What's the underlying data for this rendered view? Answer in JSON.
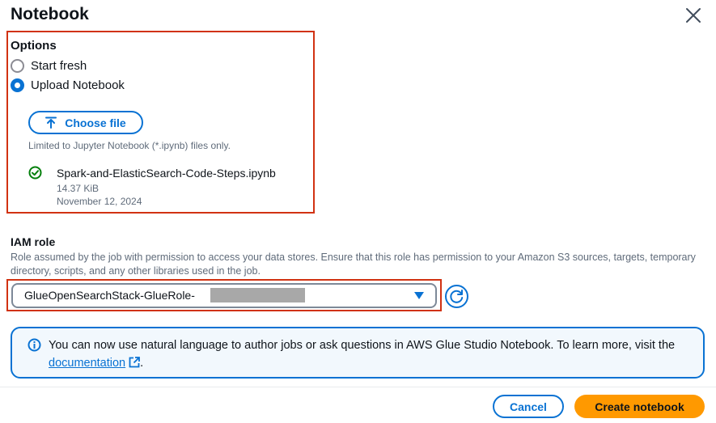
{
  "modal": {
    "title": "Notebook"
  },
  "options": {
    "label": "Options",
    "radios": [
      {
        "label": "Start fresh",
        "checked": false
      },
      {
        "label": "Upload Notebook",
        "checked": true
      }
    ],
    "choose_file_label": "Choose file",
    "hint": "Limited to Jupyter Notebook (*.ipynb) files only.",
    "file": {
      "name": "Spark-and-ElasticSearch-Code-Steps.ipynb",
      "size": "14.37 KiB",
      "date": "November 12, 2024"
    }
  },
  "iam": {
    "label": "IAM role",
    "description": "Role assumed by the job with permission to access your data stores. Ensure that this role has permission to your Amazon S3 sources, targets, temporary directory, scripts, and any other libraries used in the job.",
    "selected_value": "GlueOpenSearchStack-GlueRole-"
  },
  "alert": {
    "text": "You can now use natural language to author jobs or ask questions in AWS Glue Studio Notebook. To learn more, visit the",
    "link_text": "documentation",
    "trailing": "."
  },
  "footer": {
    "cancel_label": "Cancel",
    "create_label": "Create notebook"
  },
  "colors": {
    "accent": "#0972d3",
    "highlight_box": "#d13212",
    "primary_button": "#ff9900",
    "success": "#037f0c"
  },
  "icons": {
    "close": "close-icon",
    "upload": "upload-icon",
    "success": "check-circle-icon",
    "caret": "caret-down-icon",
    "refresh": "refresh-icon",
    "info": "info-icon",
    "external": "external-link-icon"
  }
}
